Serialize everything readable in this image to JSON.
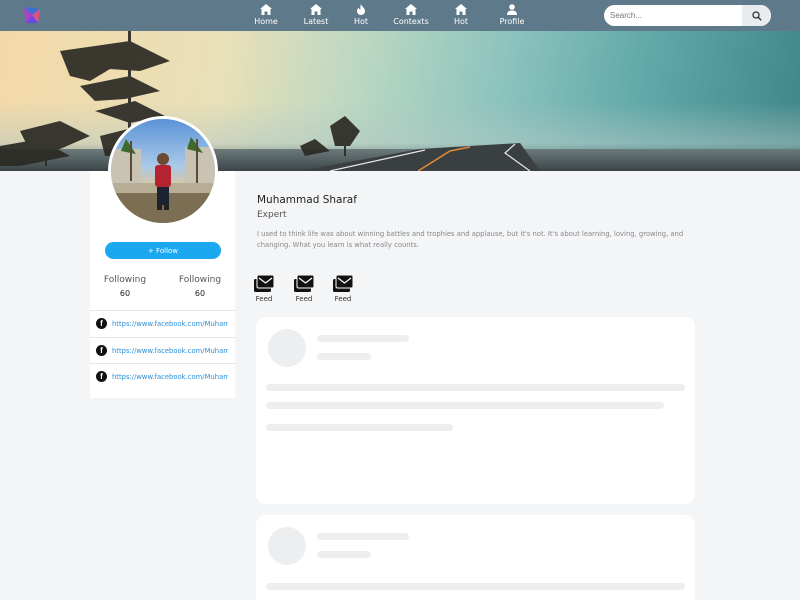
{
  "nav": {
    "items": [
      {
        "label": "Home",
        "icon": "home-icon"
      },
      {
        "label": "Latest",
        "icon": "home-icon"
      },
      {
        "label": "Hot",
        "icon": "fire-icon"
      },
      {
        "label": "Contexts",
        "icon": "home-icon"
      },
      {
        "label": "Hot",
        "icon": "home-icon"
      },
      {
        "label": "Profile",
        "icon": "user-icon"
      }
    ],
    "search": {
      "placeholder": "Search...",
      "value": ""
    },
    "bar_color": "#5e7a8a"
  },
  "profile": {
    "name": "Muhammad Sharaf",
    "role": "Expert",
    "bio": "I used to think life was about winning battles and trophies and applause, but it's not. It's about learning, loving, growing, and changing. What you learn is what really counts.",
    "follow_label": "+ Follow",
    "stats": [
      {
        "label": "Following",
        "value": "60"
      },
      {
        "label": "Following",
        "value": "60"
      }
    ],
    "links": [
      {
        "icon": "facebook-icon",
        "text": "https://www.facebook.com/Muhammad"
      },
      {
        "icon": "facebook-icon",
        "text": "https://www.facebook.com/Muhammad"
      },
      {
        "icon": "facebook-icon",
        "text": "https://www.facebook.com/Muhammad"
      }
    ]
  },
  "tabs": [
    {
      "label": "Feed",
      "icon": "feed-icon"
    },
    {
      "label": "Feed",
      "icon": "feed-icon"
    },
    {
      "label": "Feed",
      "icon": "feed-icon"
    }
  ],
  "colors": {
    "accent": "#1ca8f0",
    "link": "#2a8fd6",
    "skeleton": "#eceef0"
  }
}
